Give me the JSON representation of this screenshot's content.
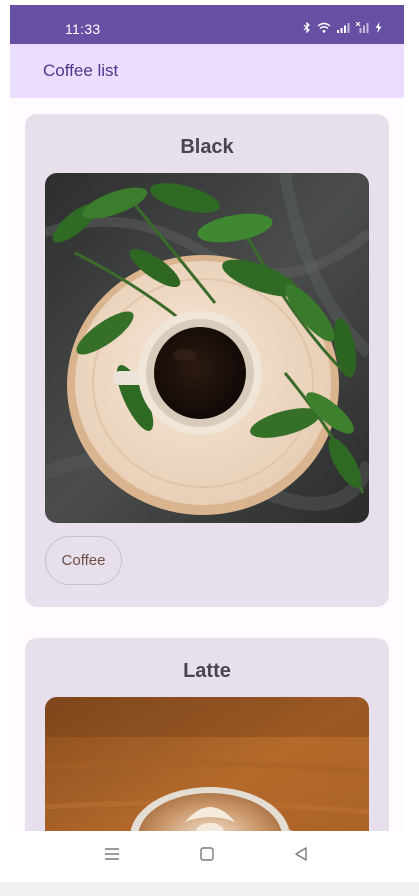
{
  "status_bar": {
    "time": "11:33",
    "icons": [
      "bluetooth-icon",
      "wifi-icon",
      "signal-icon",
      "signal-no-service-icon",
      "battery-charging-icon"
    ]
  },
  "app_bar": {
    "title": "Coffee list"
  },
  "coffees": [
    {
      "title": "Black",
      "image": "black-coffee-cup-with-leaves-photo",
      "chips": [
        "Coffee"
      ]
    },
    {
      "title": "Latte",
      "image": "latte-art-cup-photo"
    }
  ],
  "nav_bar": {
    "buttons": [
      "menu-icon",
      "home-icon",
      "back-icon"
    ]
  },
  "colors": {
    "status_bar": "#6750a4",
    "app_bar": "#eaddff",
    "app_bar_title": "#4f378b",
    "card": "#e7e0ec",
    "card_title": "#49454f"
  }
}
